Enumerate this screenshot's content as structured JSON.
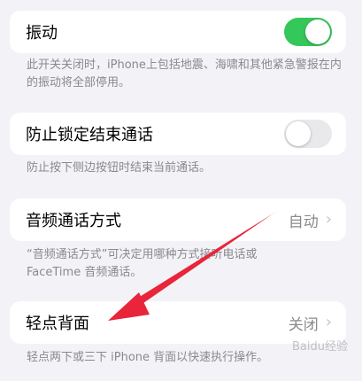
{
  "colors": {
    "accent_green": "#34c759",
    "arrow_red": "#e8253a",
    "background": "#f2f2f7"
  },
  "settings": [
    {
      "label": "振动",
      "control": "toggle",
      "on": true
    },
    {
      "label": "防止锁定结束通话",
      "control": "toggle",
      "on": false
    },
    {
      "label": "音频通话方式",
      "value": "自动",
      "control": "chevron"
    },
    {
      "label": "轻点背面",
      "value": "关闭",
      "control": "chevron"
    }
  ],
  "notes": {
    "vibration": "此开关关闭时，iPhone上包括地震、海啸和其他紧急警报在内的振动将全部停用。",
    "prevent_lock": "防止按下侧边按钮时结束当前通话。",
    "audio_routing_line1": "“音频通话方式”可决定用哪种方式接听电话或",
    "audio_routing_line2": "FaceTime 音频通话。",
    "back_tap": "轻点两下或三下 iPhone 背面以快速执行操作。"
  },
  "watermark": "Baidu经验"
}
